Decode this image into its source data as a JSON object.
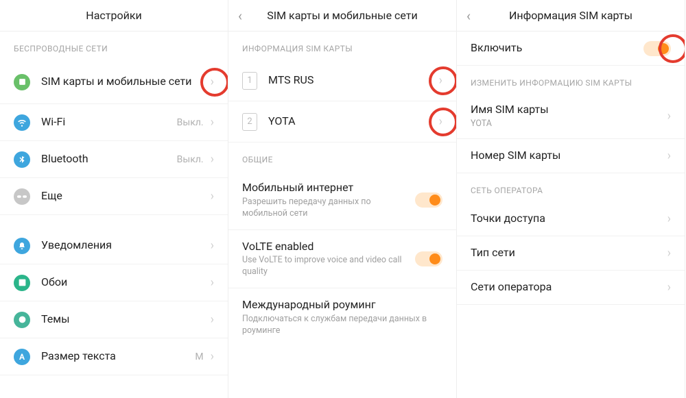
{
  "panel1": {
    "title": "Настройки",
    "section1": "БЕСПРОВОДНЫЕ СЕТИ",
    "rows": {
      "sim": "SIM карты и мобильные сети",
      "wifi": "Wi-Fi",
      "wifi_val": "Выкл.",
      "bt": "Bluetooth",
      "bt_val": "Выкл.",
      "more": "Еще",
      "notif": "Уведомления",
      "wallpaper": "Обои",
      "themes": "Темы",
      "textsize": "Размер текста",
      "textsize_val": "M"
    },
    "colors": {
      "sim": "#69c069",
      "wifi": "#3ea6de",
      "bt": "#3ea6de",
      "more": "#c7c7c7",
      "notif": "#3ea6de",
      "wallpaper": "#2bb58a",
      "themes": "#46b59a",
      "textsize": "#3ea6de"
    }
  },
  "panel2": {
    "title": "SIM карты и мобильные сети",
    "section1": "ИНФОРМАЦИЯ SIM КАРТЫ",
    "sim1": "MTS RUS",
    "sim2": "YOTA",
    "section2": "ОБЩИЕ",
    "mobile_data": "Мобильный интернет",
    "mobile_data_sub": "Разрешить передачу данных по мобильной сети",
    "volte": "VoLTE enabled",
    "volte_sub": "Use VoLTE to improve voice and video call quality",
    "roaming": "Международный роуминг",
    "roaming_sub": "Подключаться к службам передачи данных в роуминге"
  },
  "panel3": {
    "title": "Информация SIM карты",
    "enable": "Включить",
    "section1": "ИЗМЕНИТЬ ИНФОРМАЦИЮ SIM КАРТЫ",
    "sim_name": "Имя SIM карты",
    "sim_name_val": "YOTA",
    "sim_number": "Номер SIM карты",
    "section2": "СЕТЬ ОПЕРАТОРА",
    "apn": "Точки доступа",
    "net_type": "Тип сети",
    "operators": "Сети оператора"
  }
}
